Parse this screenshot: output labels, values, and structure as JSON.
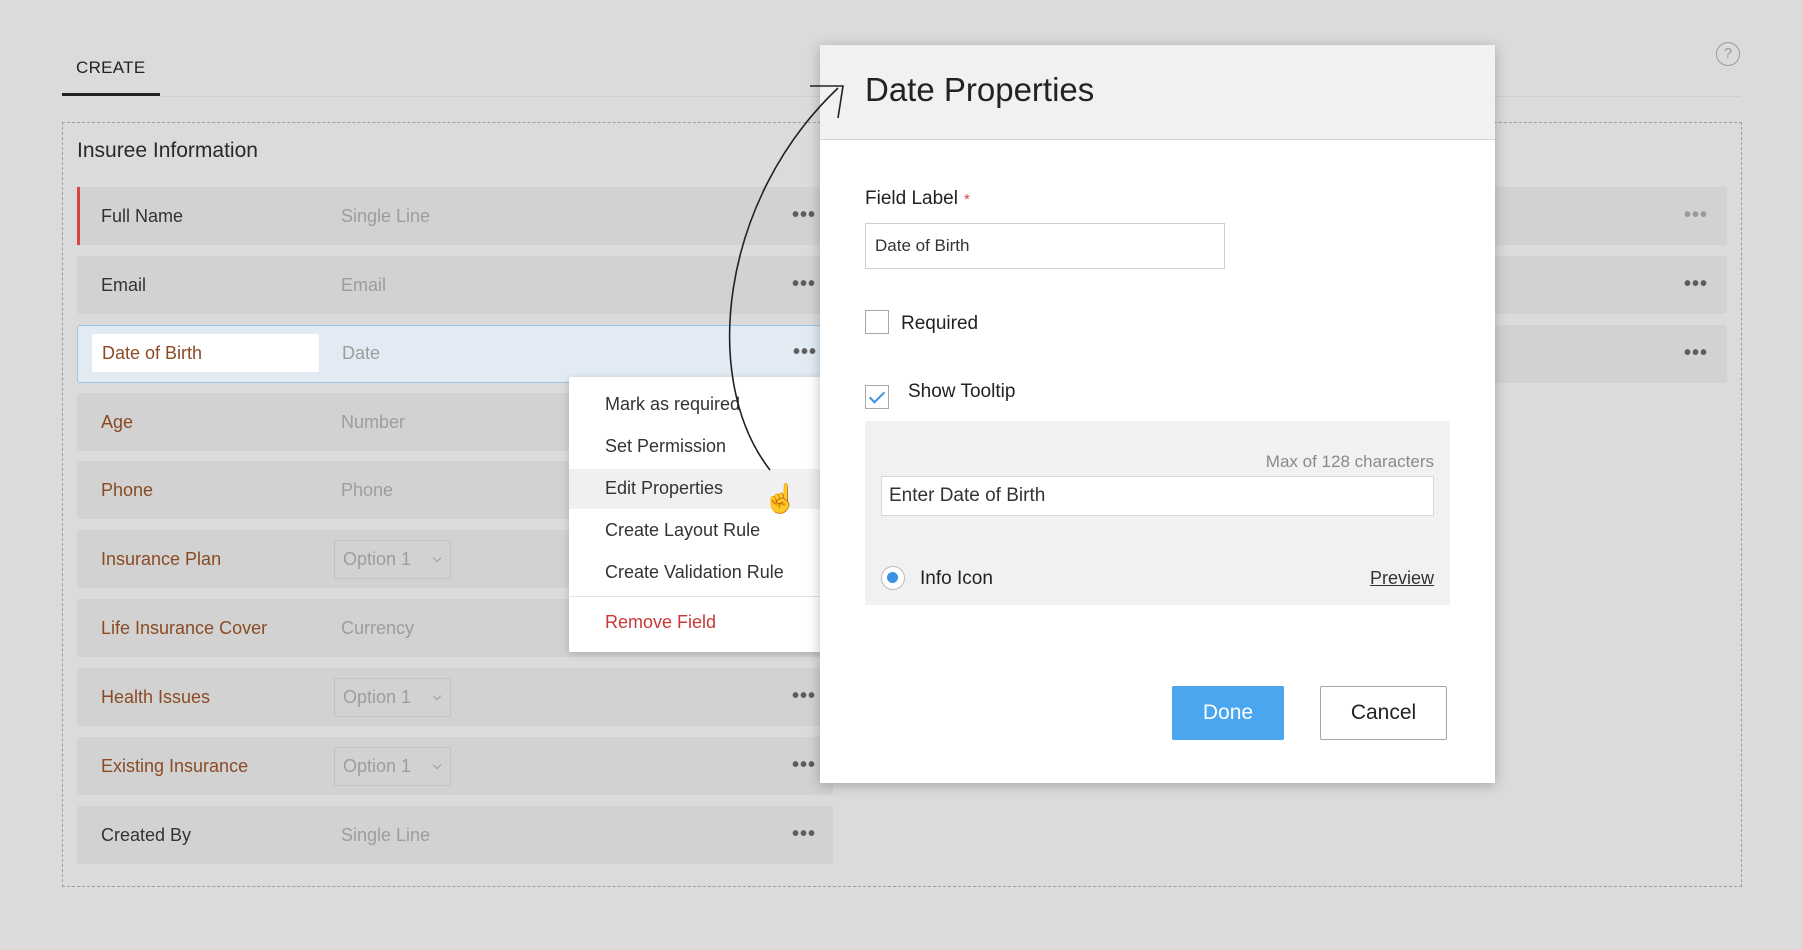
{
  "tabs": {
    "create_label": "CREATE"
  },
  "help": {
    "glyph": "?"
  },
  "section": {
    "title": "Insuree Information"
  },
  "fields": [
    {
      "label": "Full Name",
      "type": "Single Line"
    },
    {
      "label": "Email",
      "type": "Email"
    },
    {
      "label": "Date of Birth",
      "type": "Date"
    },
    {
      "label": "Age",
      "type": "Number"
    },
    {
      "label": "Phone",
      "type": "Phone"
    },
    {
      "label": "Insurance Plan",
      "type": "Option 1"
    },
    {
      "label": "Life Insurance Cover",
      "type": "Currency"
    },
    {
      "label": "Health Issues",
      "type": "Option 1"
    },
    {
      "label": "Existing Insurance",
      "type": "Option 1"
    },
    {
      "label": "Created By",
      "type": "Single Line"
    }
  ],
  "more_glyph": "•••",
  "context_menu": {
    "items": [
      "Mark as required",
      "Set Permission",
      "Edit Properties",
      "Create Layout Rule",
      "Create Validation Rule"
    ],
    "danger_item": "Remove Field",
    "highlighted": "Edit Properties"
  },
  "dialog": {
    "title": "Date Properties",
    "field_label": "Field Label",
    "required_marker": "*",
    "field_label_value": "Date of Birth",
    "required_label": "Required",
    "required_checked": false,
    "show_tooltip_label": "Show Tooltip",
    "show_tooltip_checked": true,
    "max_chars": "Max of 128 characters",
    "tooltip_value": "Enter Date of Birth",
    "info_icon_label": "Info Icon",
    "preview_label": "Preview",
    "done_label": "Done",
    "cancel_label": "Cancel"
  },
  "colors": {
    "accent_blue": "#4aa6ef",
    "required_red": "#d64545",
    "label_brown": "#8a4b24"
  }
}
